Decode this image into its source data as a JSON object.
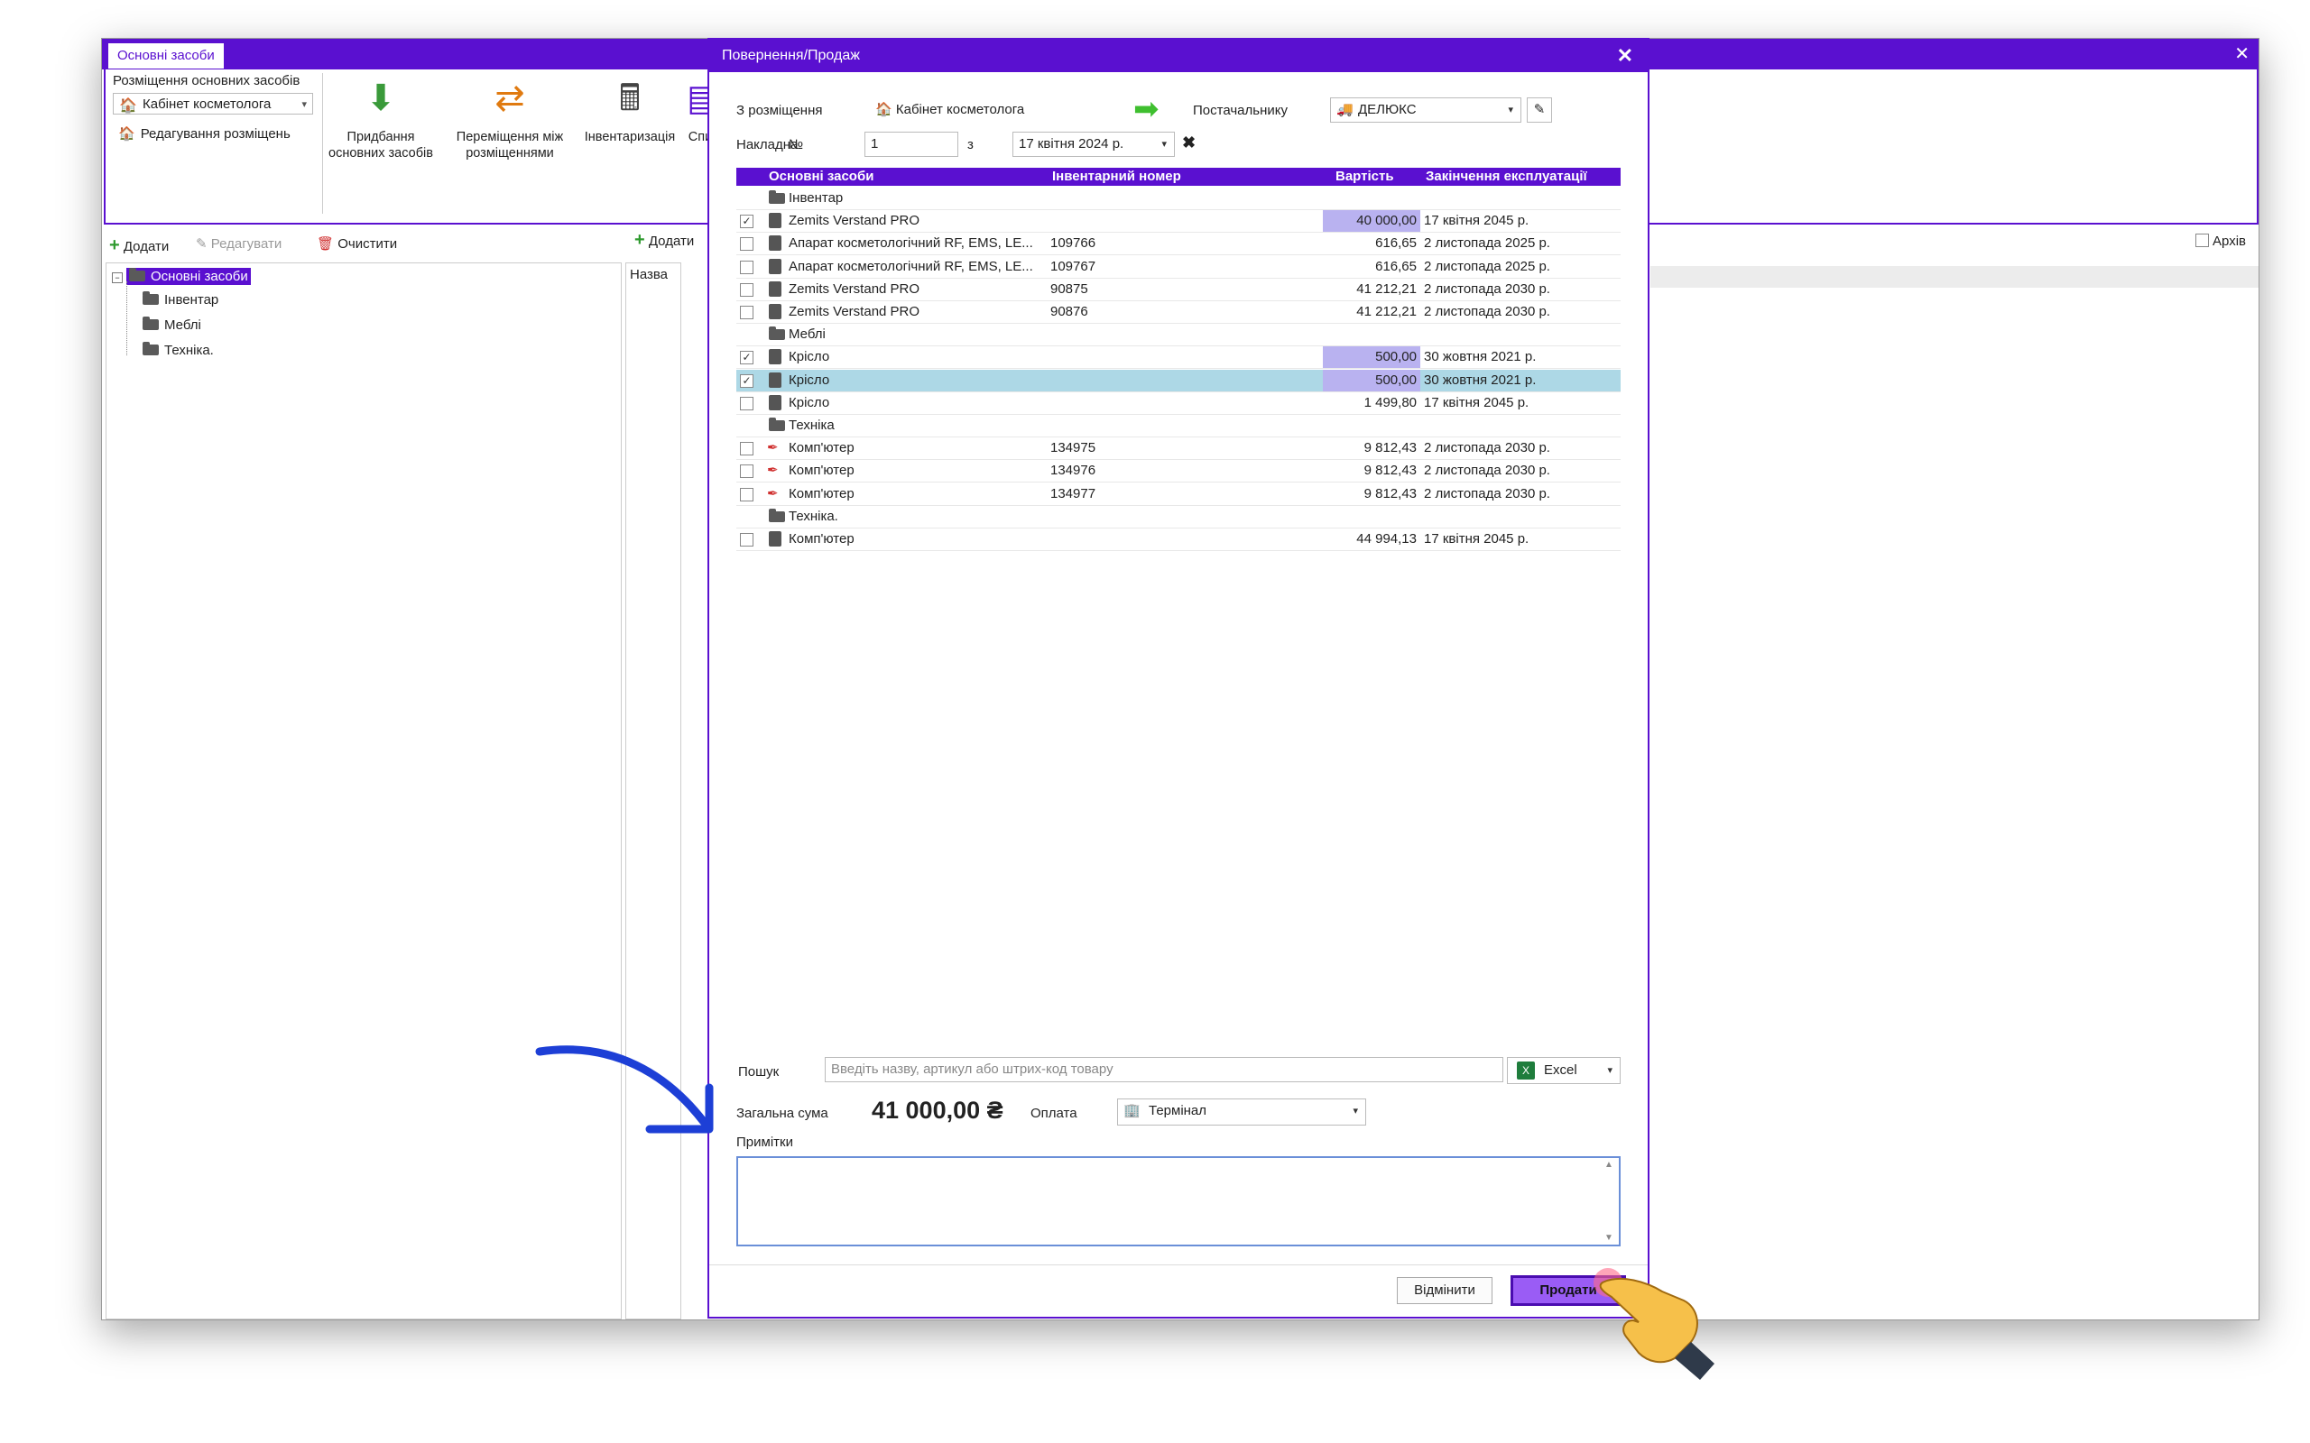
{
  "main": {
    "tab_label": "Основні засоби",
    "ribbon": {
      "placement_group_label": "Розміщення основних засобів",
      "placement_value": "Кабінет косметолога",
      "edit_placement": "Редагування розміщень",
      "buttons": [
        {
          "label_line1": "Придбання",
          "label_line2": "основних засобів"
        },
        {
          "label_line1": "Переміщення між",
          "label_line2": "розміщеннями"
        },
        {
          "label_line1": "Інвентаризація",
          "label_line2": ""
        },
        {
          "label_line1": "Спи",
          "label_line2": ""
        }
      ]
    },
    "left_toolbar": {
      "add": "Додати",
      "edit": "Редагувати",
      "clear": "Очистити"
    },
    "tree": {
      "root": "Основні засоби",
      "children": [
        "Інвентар",
        "Меблі",
        "Техніка."
      ]
    },
    "middle_toolbar": {
      "add": "Додати",
      "name_header": "Назва"
    },
    "archive_label": "Архів"
  },
  "dialog": {
    "title": "Повернення/Продаж",
    "from_label": "З розміщення",
    "from_value": "Кабінет косметолога",
    "supplier_label": "Постачальнику",
    "supplier_value": "ДЕЛЮКС",
    "invoice_label": "Накладна",
    "number_label": "№",
    "invoice_number": "1",
    "from_date_label": "з",
    "invoice_date": "17 квітня 2024 р.",
    "table": {
      "headers": {
        "name": "Основні засоби",
        "inv": "Інвентарний номер",
        "cost": "Вартість",
        "end": "Закінчення експлуатації"
      },
      "rows": [
        {
          "type": "group",
          "name": "Інвентар"
        },
        {
          "type": "item",
          "checked": "✓",
          "name": "Zemits Verstand PRO",
          "inv": "",
          "cost": "40 000,00",
          "end": "17 квітня 2045 р.",
          "hl": true
        },
        {
          "type": "item",
          "checked": "",
          "name": "Апарат косметологічний RF, EMS, LE...",
          "inv": "109766",
          "cost": "616,65",
          "end": "2 листопада 2025 р."
        },
        {
          "type": "item",
          "checked": "",
          "name": "Апарат косметологічний RF, EMS, LE...",
          "inv": "109767",
          "cost": "616,65",
          "end": "2 листопада 2025 р."
        },
        {
          "type": "item",
          "checked": "",
          "name": "Zemits Verstand PRO",
          "inv": "90875",
          "cost": "41 212,21",
          "end": "2 листопада 2030 р."
        },
        {
          "type": "item",
          "checked": "",
          "name": "Zemits Verstand PRO",
          "inv": "90876",
          "cost": "41 212,21",
          "end": "2 листопада 2030 р."
        },
        {
          "type": "group",
          "name": "Меблі"
        },
        {
          "type": "item",
          "checked": "✓",
          "name": "Крісло",
          "inv": "",
          "cost": "500,00",
          "end": "30 жовтня 2021 р.",
          "hl": true
        },
        {
          "type": "item",
          "checked": "✓",
          "name": "Крісло",
          "inv": "",
          "cost": "500,00",
          "end": "30 жовтня 2021 р.",
          "hl": true,
          "selected": true
        },
        {
          "type": "item",
          "checked": "",
          "name": "Крісло",
          "inv": "",
          "cost": "1 499,80",
          "end": "17 квітня 2045 р."
        },
        {
          "type": "group",
          "name": "Техніка"
        },
        {
          "type": "item",
          "checked": "",
          "icon": "pen",
          "name": "Комп'ютер",
          "inv": "134975",
          "cost": "9 812,43",
          "end": "2 листопада 2030 р."
        },
        {
          "type": "item",
          "checked": "",
          "icon": "pen",
          "name": "Комп'ютер",
          "inv": "134976",
          "cost": "9 812,43",
          "end": "2 листопада 2030 р."
        },
        {
          "type": "item",
          "checked": "",
          "icon": "pen",
          "name": "Комп'ютер",
          "inv": "134977",
          "cost": "9 812,43",
          "end": "2 листопада 2030 р."
        },
        {
          "type": "group",
          "name": "Техніка."
        },
        {
          "type": "item",
          "checked": "",
          "name": "Комп'ютер",
          "inv": "",
          "cost": "44 994,13",
          "end": "17 квітня 2045 р."
        }
      ]
    },
    "search_label": "Пошук",
    "search_placeholder": "Введіть назву, артикул або штрих-код товару",
    "excel_label": "Excel",
    "total_label": "Загальна сума",
    "total_value": "41 000,00 ₴",
    "payment_label": "Оплата",
    "payment_value": "Термінал",
    "notes_label": "Примітки",
    "cancel_label": "Відмінити",
    "sell_label": "Продати"
  },
  "colors": {
    "accent": "#5a10d0",
    "highlight": "#b9b2f0",
    "selected_row": "#add8e6"
  }
}
